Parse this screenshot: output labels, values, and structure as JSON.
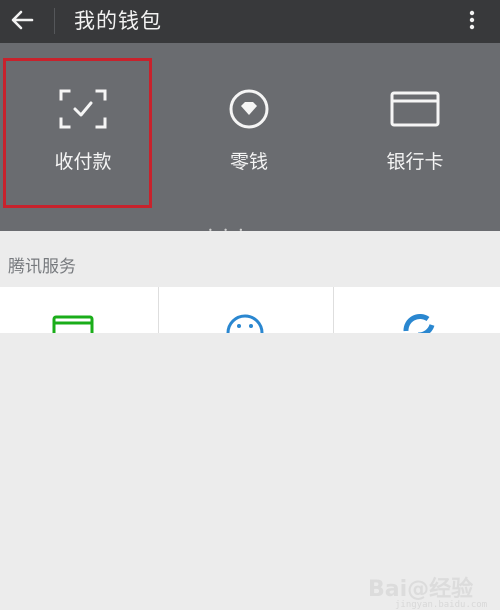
{
  "header": {
    "title": "我的钱包"
  },
  "wallet": {
    "items": [
      {
        "label": "收付款",
        "icon": "scan-check-icon"
      },
      {
        "label": "零钱",
        "icon": "coin-diamond-icon"
      },
      {
        "label": "银行卡",
        "icon": "bank-card-icon"
      }
    ]
  },
  "services": {
    "title": "腾讯服务"
  },
  "watermark": {
    "text": "Bai@经验",
    "sub": "jingyan.baidu.com"
  },
  "colors": {
    "header_bg": "#38393b",
    "panel_bg": "#6a6c70",
    "highlight": "#c8222c",
    "accent_green": "#1aad19",
    "accent_blue": "#2a87d0"
  }
}
